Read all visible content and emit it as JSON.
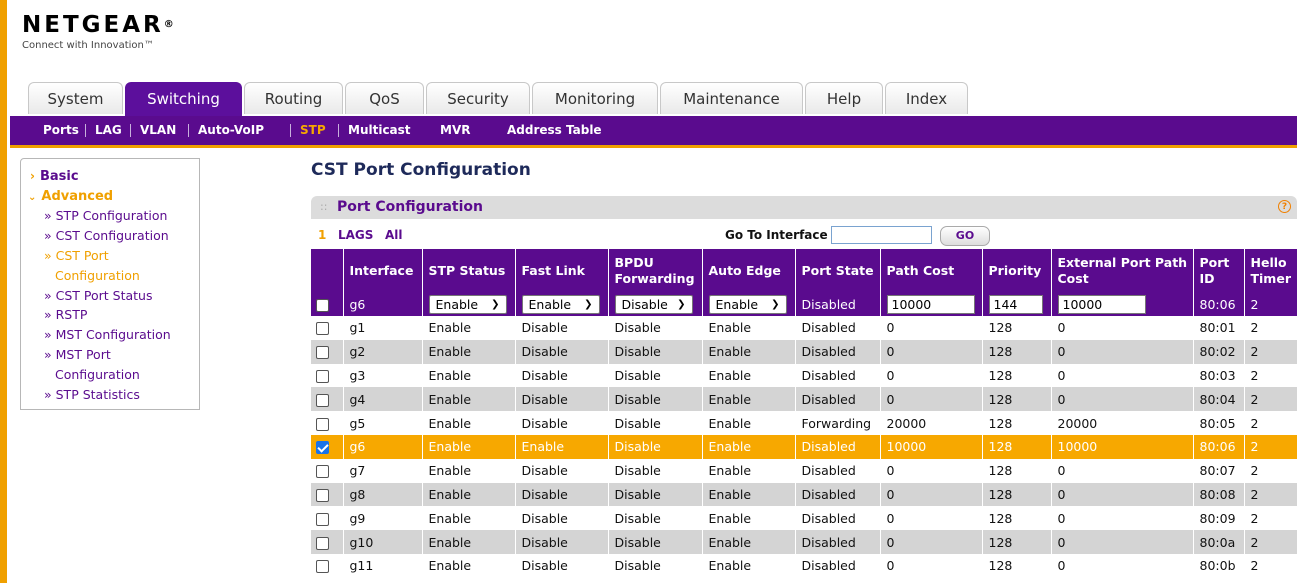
{
  "brand": {
    "name": "NETGEAR",
    "registered": "®",
    "tagline": "Connect with Innovation™"
  },
  "tabs": [
    {
      "label": "System",
      "active": false
    },
    {
      "label": "Switching",
      "active": true
    },
    {
      "label": "Routing",
      "active": false
    },
    {
      "label": "QoS",
      "active": false
    },
    {
      "label": "Security",
      "active": false
    },
    {
      "label": "Monitoring",
      "active": false
    },
    {
      "label": "Maintenance",
      "active": false
    },
    {
      "label": "Help",
      "active": false
    },
    {
      "label": "Index",
      "active": false
    }
  ],
  "subnav": [
    "Ports",
    "LAG",
    "VLAN",
    "Auto-VoIP",
    "STP",
    "Multicast",
    "MVR",
    "Address Table"
  ],
  "subnav_active": "STP",
  "sidebar": {
    "basic": "Basic",
    "advanced": "Advanced",
    "items": [
      "» STP Configuration",
      "» CST Configuration",
      "» CST Port",
      "Configuration",
      "» CST Port Status",
      "» RSTP",
      "» MST Configuration",
      "» MST Port",
      "Configuration",
      "» STP Statistics"
    ]
  },
  "page_title": "CST Port Configuration",
  "panel": {
    "title": "Port Configuration",
    "help": "?"
  },
  "filters": {
    "one": "1",
    "lags": "LAGS",
    "all": "All",
    "goto_label": "Go To Interface",
    "goto_value": "",
    "go": "GO"
  },
  "columns": [
    "",
    "Interface",
    "STP Status",
    "Fast Link",
    "BPDU Forwarding",
    "Auto Edge",
    "Port State",
    "Path Cost",
    "Priority",
    "External Port Path Cost",
    "Port ID",
    "Hello Timer"
  ],
  "edit_row": {
    "interface": "g6",
    "stp_status": "Enable",
    "fast_link": "Enable",
    "bpdu_forwarding": "Disable",
    "auto_edge": "Enable",
    "port_state": "Disabled",
    "path_cost": "10000",
    "priority": "144",
    "ext_path_cost": "10000",
    "port_id": "80:06",
    "hello_timer": "2"
  },
  "rows": [
    [
      "g1",
      "Enable",
      "Disable",
      "Disable",
      "Enable",
      "Disabled",
      "0",
      "128",
      "0",
      "80:01",
      "2"
    ],
    [
      "g2",
      "Enable",
      "Disable",
      "Disable",
      "Enable",
      "Disabled",
      "0",
      "128",
      "0",
      "80:02",
      "2"
    ],
    [
      "g3",
      "Enable",
      "Disable",
      "Disable",
      "Enable",
      "Disabled",
      "0",
      "128",
      "0",
      "80:03",
      "2"
    ],
    [
      "g4",
      "Enable",
      "Disable",
      "Disable",
      "Enable",
      "Disabled",
      "0",
      "128",
      "0",
      "80:04",
      "2"
    ],
    [
      "g5",
      "Enable",
      "Disable",
      "Disable",
      "Enable",
      "Forwarding",
      "20000",
      "128",
      "20000",
      "80:05",
      "2"
    ],
    [
      "g6",
      "Enable",
      "Enable",
      "Disable",
      "Enable",
      "Disabled",
      "10000",
      "128",
      "10000",
      "80:06",
      "2"
    ],
    [
      "g7",
      "Enable",
      "Disable",
      "Disable",
      "Enable",
      "Disabled",
      "0",
      "128",
      "0",
      "80:07",
      "2"
    ],
    [
      "g8",
      "Enable",
      "Disable",
      "Disable",
      "Enable",
      "Disabled",
      "0",
      "128",
      "0",
      "80:08",
      "2"
    ],
    [
      "g9",
      "Enable",
      "Disable",
      "Disable",
      "Enable",
      "Disabled",
      "0",
      "128",
      "0",
      "80:09",
      "2"
    ],
    [
      "g10",
      "Enable",
      "Disable",
      "Disable",
      "Enable",
      "Disabled",
      "0",
      "128",
      "0",
      "80:0a",
      "2"
    ],
    [
      "g11",
      "Enable",
      "Disable",
      "Disable",
      "Enable",
      "Disabled",
      "0",
      "128",
      "0",
      "80:0b",
      "2"
    ]
  ],
  "selected_row": 5,
  "colors": {
    "purple": "#5a0b8e",
    "orange": "#f7a800",
    "row_alt": "#d4d4d4"
  }
}
